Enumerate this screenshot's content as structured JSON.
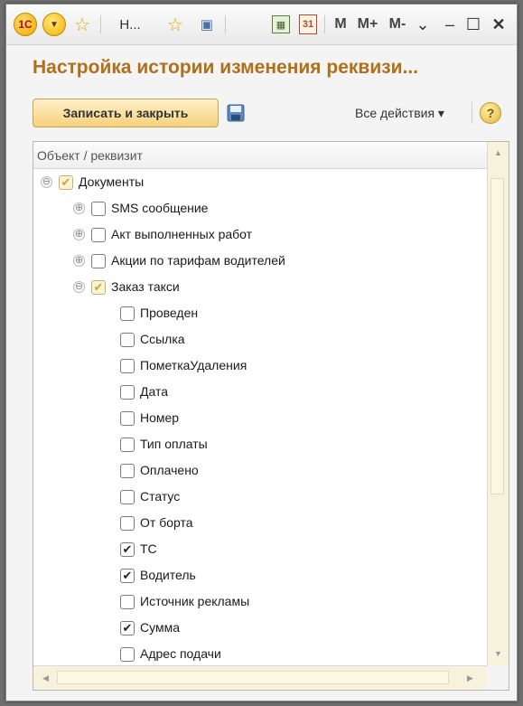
{
  "titlebar": {
    "logo_text": "1С",
    "dropdown_glyph": "▼",
    "star_glyph": "☆",
    "window_short_title": "Н...",
    "favorite_add_glyph": "☆",
    "history_glyph": "▣",
    "calculator_glyph": "▦",
    "calendar_glyph": "31",
    "m_label": "M",
    "m_plus_label": "M+",
    "m_minus_label": "M-",
    "menu_glyph": "⌄",
    "minimize_glyph": "–",
    "maximize_glyph": "☐",
    "close_glyph": "✕"
  },
  "header": {
    "title": "Настройка истории изменения реквизи..."
  },
  "toolbar": {
    "save_close_label": "Записать и закрыть",
    "save_icon": "floppy-disk-icon",
    "all_actions_label": "Все действия ▾",
    "help_label": "?"
  },
  "tree": {
    "column_header": "Объект / реквизит",
    "rows": [
      {
        "label": "Документы",
        "level": 0,
        "expander": "⊖",
        "checked": "partial"
      },
      {
        "label": "SMS сообщение",
        "level": 1,
        "expander": "⊕",
        "checked": "no"
      },
      {
        "label": "Акт выполненных работ",
        "level": 1,
        "expander": "⊕",
        "checked": "no"
      },
      {
        "label": "Акции по тарифам водителей",
        "level": 1,
        "expander": "⊕",
        "checked": "no"
      },
      {
        "label": "Заказ такси",
        "level": 1,
        "expander": "⊖",
        "checked": "partial"
      },
      {
        "label": "Проведен",
        "level": 2,
        "checked": "no"
      },
      {
        "label": "Ссылка",
        "level": 2,
        "checked": "no"
      },
      {
        "label": "ПометкаУдаления",
        "level": 2,
        "checked": "no"
      },
      {
        "label": "Дата",
        "level": 2,
        "checked": "no"
      },
      {
        "label": "Номер",
        "level": 2,
        "checked": "no"
      },
      {
        "label": "Тип оплаты",
        "level": 2,
        "checked": "no"
      },
      {
        "label": "Оплачено",
        "level": 2,
        "checked": "no"
      },
      {
        "label": "Статус",
        "level": 2,
        "checked": "no"
      },
      {
        "label": "От борта",
        "level": 2,
        "checked": "no"
      },
      {
        "label": "ТС",
        "level": 2,
        "checked": "yes"
      },
      {
        "label": "Водитель",
        "level": 2,
        "checked": "yes"
      },
      {
        "label": "Источник рекламы",
        "level": 2,
        "checked": "no"
      },
      {
        "label": "Сумма",
        "level": 2,
        "checked": "yes"
      },
      {
        "label": "Адрес подачи",
        "level": 2,
        "checked": "no"
      }
    ]
  },
  "scroll": {
    "up_glyph": "▲",
    "down_glyph": "▼",
    "left_glyph": "◀",
    "right_glyph": "▶"
  },
  "colors": {
    "title": "#b0701a",
    "button_bg": "#f6d27c",
    "scroll_bg": "#f7f2dc"
  }
}
